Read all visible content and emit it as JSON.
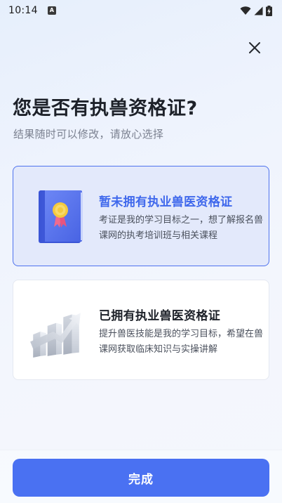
{
  "status_bar": {
    "time": "10:14",
    "a_badge": "A",
    "icons": [
      "wifi-icon",
      "signal-icon",
      "battery-charging-icon"
    ]
  },
  "header": {
    "close_icon": "close-icon",
    "title": "您是否有执兽资格证?",
    "subtitle": "结果随时可以修改，请放心选择"
  },
  "options": [
    {
      "title": "暂未拥有执业兽医资格证",
      "description": "考证是我的学习目标之一，想了解报名兽课网的执考培训班与相关课程",
      "icon": "certificate-book-icon",
      "selected": true
    },
    {
      "title": "已拥有执业兽医资格证",
      "description": "提升兽医技能是我的学习目标，希望在兽课网获取临床知识与实操讲解",
      "icon": "growth-bar-chart-icon",
      "selected": false
    }
  ],
  "footer": {
    "done_label": "完成"
  },
  "colors": {
    "accent": "#4a71f2",
    "selected_title": "#3f68ec",
    "selected_bg": "#e3e9fb"
  }
}
